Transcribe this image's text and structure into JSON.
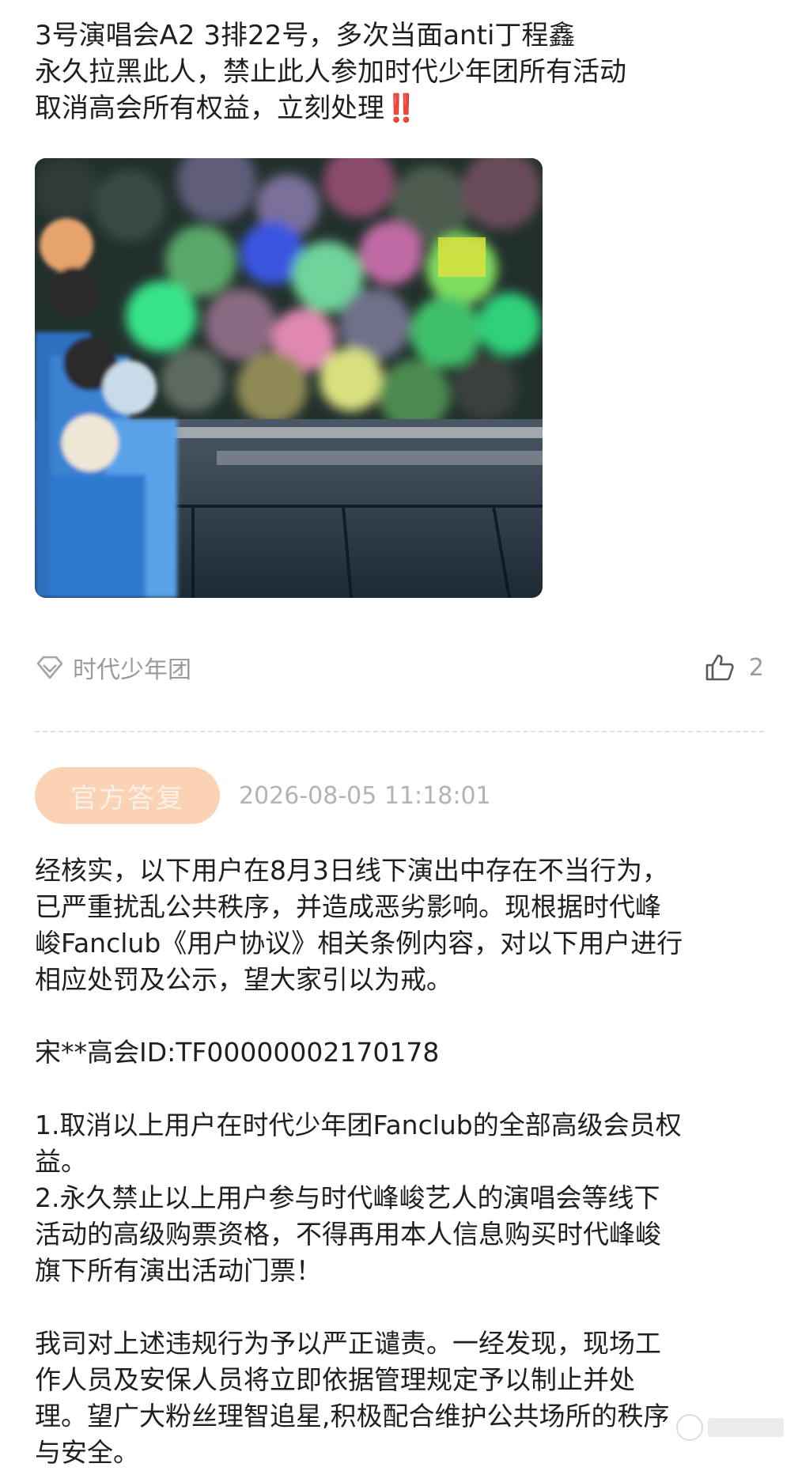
{
  "post": {
    "lines": [
      "3号演唱会A2 3排22号，多次当面anti丁程鑫",
      "永久拉黑此人，禁止此人参加时代少年团所有活动",
      "取消高会所有权益，立刻处理"
    ],
    "emphasis": "‼️"
  },
  "photo": {
    "icon": "concert-photo"
  },
  "meta": {
    "tag_label": "时代少年团",
    "tag_icon": "diamond-tag-icon",
    "like_icon": "thumbs-up-icon",
    "like_count": "2"
  },
  "reply": {
    "badge": "官方答复",
    "timestamp": "2026-08-05 11:18:01",
    "paragraph1": [
      "经核实，以下用户在8月3日线下演出中存在不当行为，",
      "已严重扰乱公共秩序，并造成恶劣影响。现根据时代峰",
      "峻Fanclub《用户协议》相关条例内容，对以下用户进行",
      "相应处罚及公示，望大家引以为戒。"
    ],
    "user_line": "宋**高会ID:TF00000002170178",
    "penalties": [
      "1.取消以上用户在时代少年团Fanclub的全部高级会员权",
      "益。",
      "2.永久禁止以上用户参与时代峰峻艺人的演唱会等线下",
      "活动的高级购票资格，不得再用本人信息购买时代峰峻",
      "旗下所有演出活动门票！"
    ],
    "closing": [
      "我司对上述违规行为予以严正谴责。一经发现，现场工",
      "作人员及安保人员将立即依据管理规定予以制止并处",
      "理。望广大粉丝理智追星,积极配合维护公共场所的秩序",
      "与安全。"
    ]
  },
  "colors": {
    "badge_bg": "#fbd3b4",
    "muted": "#9b9b9b",
    "alert": "#e11d2c"
  }
}
